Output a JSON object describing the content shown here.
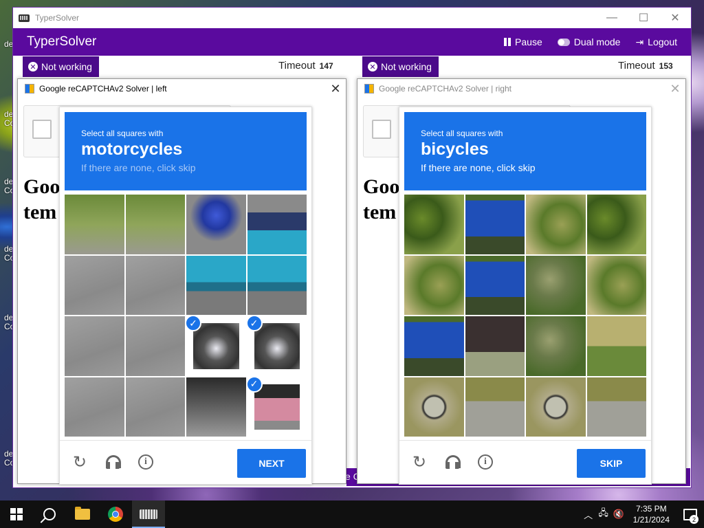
{
  "window": {
    "title": "TyperSolver",
    "minimize": "—",
    "maximize": "☐",
    "close": "✕"
  },
  "header": {
    "app_name": "TyperSolver",
    "pause_label": "Pause",
    "dual_mode_label": "Dual mode",
    "logout_label": "Logout"
  },
  "left_panel": {
    "status": "Not working",
    "timeout_label": "Timeout",
    "timeout_value": "147",
    "solver_title": "Google reCAPTCHAv2 Solver | left",
    "bg_text_line1": "Goo",
    "bg_text_line2": "tem",
    "challenge": {
      "instruction": "Select all squares with",
      "target": "motorcycles",
      "hint": "If there are none, click skip",
      "button_label": "NEXT",
      "selected_tiles": [
        10,
        11,
        15
      ]
    }
  },
  "right_panel": {
    "status": "Not working",
    "timeout_label": "Timeout",
    "timeout_value": "153",
    "solver_title": "Google reCAPTCHAv2 Solver | right",
    "bg_text_line1": "Goo",
    "bg_text_line2": "tem",
    "challenge": {
      "instruction": "Select all squares with",
      "target": "bicycles",
      "hint": "If there are none, click skip",
      "button_label": "SKIP",
      "selected_tiles": []
    }
  },
  "bottom_strip_text": "e C",
  "desktop_icons": [
    "de",
    "de",
    "Co",
    "de",
    "Co",
    "de",
    "Co",
    "de",
    "Co",
    "de",
    "Co"
  ],
  "taskbar": {
    "time": "7:35 PM",
    "date": "1/21/2024",
    "notification_count": "2"
  },
  "colors": {
    "brand_purple": "#5a0a9e",
    "recaptcha_blue": "#1a73e8"
  }
}
